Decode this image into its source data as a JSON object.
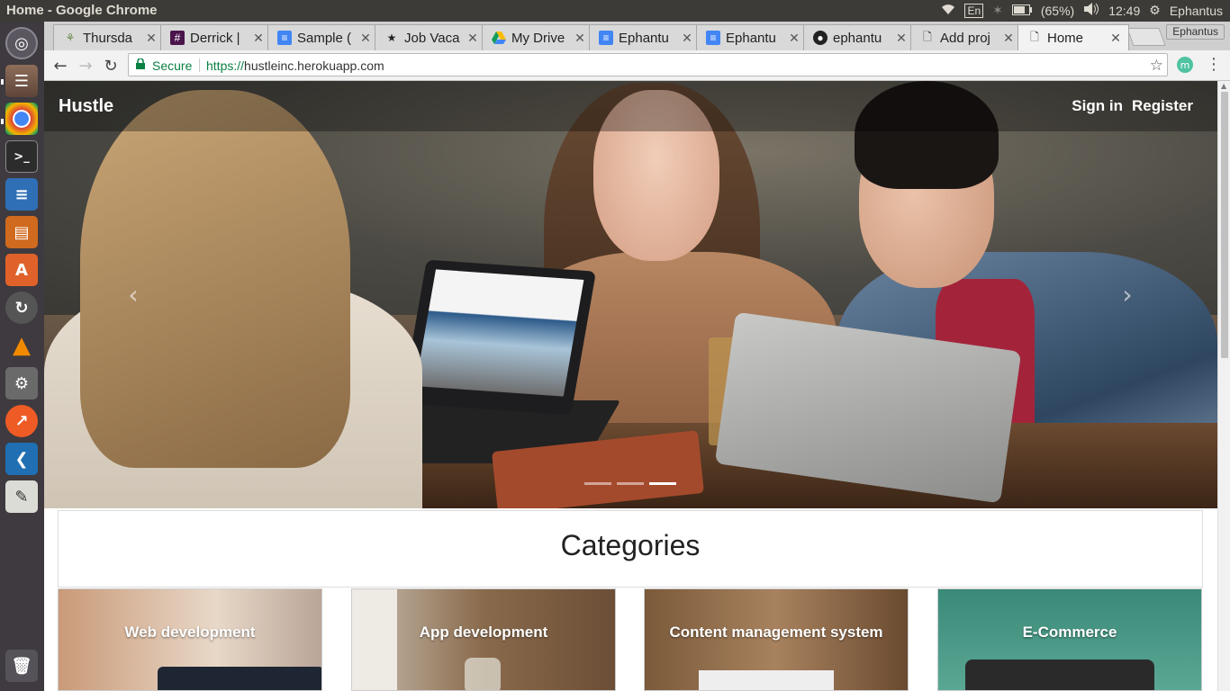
{
  "system": {
    "window_title": "Home - Google Chrome",
    "keyboard": "En",
    "battery": "(65%)",
    "time": "12:49",
    "user": "Ephantus"
  },
  "launcher": {
    "items": [
      "dash-icon",
      "files-icon",
      "chrome-icon",
      "terminal-icon",
      "writer-icon",
      "impress-icon",
      "software-center-icon",
      "updater-icon",
      "vlc-icon",
      "settings-icon",
      "postman-icon",
      "vscode-icon",
      "text-editor-icon",
      "trash-icon"
    ]
  },
  "tabs": [
    {
      "label": "Thursda",
      "icon": "palm-icon"
    },
    {
      "label": "Derrick |",
      "icon": "slack-icon"
    },
    {
      "label": "Sample (",
      "icon": "docs-icon"
    },
    {
      "label": "Job Vaca",
      "icon": "star-tab-icon"
    },
    {
      "label": "My Drive",
      "icon": "drive-icon"
    },
    {
      "label": "Ephantu",
      "icon": "docs-icon"
    },
    {
      "label": "Ephantu",
      "icon": "docs-icon"
    },
    {
      "label": "ephantu",
      "icon": "github-icon"
    },
    {
      "label": "Add proj",
      "icon": "page-icon"
    },
    {
      "label": "Home",
      "icon": "page-icon"
    }
  ],
  "browser": {
    "profile": "Ephantus",
    "secure_label": "Secure",
    "url_scheme": "https://",
    "url_host": "hustleinc.herokuapp.com"
  },
  "page": {
    "brand": "Hustle",
    "nav": {
      "sign_in": "Sign in",
      "register": "Register"
    },
    "carousel": {
      "slide_count": 3,
      "active_slide": 3
    },
    "categories_title": "Categories",
    "categories": [
      {
        "title": "Web development"
      },
      {
        "title": "App development"
      },
      {
        "title": "Content management system"
      },
      {
        "title": "E-Commerce"
      }
    ]
  },
  "colors": {
    "secure_green": "#0b8043",
    "launcher_bg": "#3e3a3f",
    "topbar_bg": "#3c3b37"
  }
}
